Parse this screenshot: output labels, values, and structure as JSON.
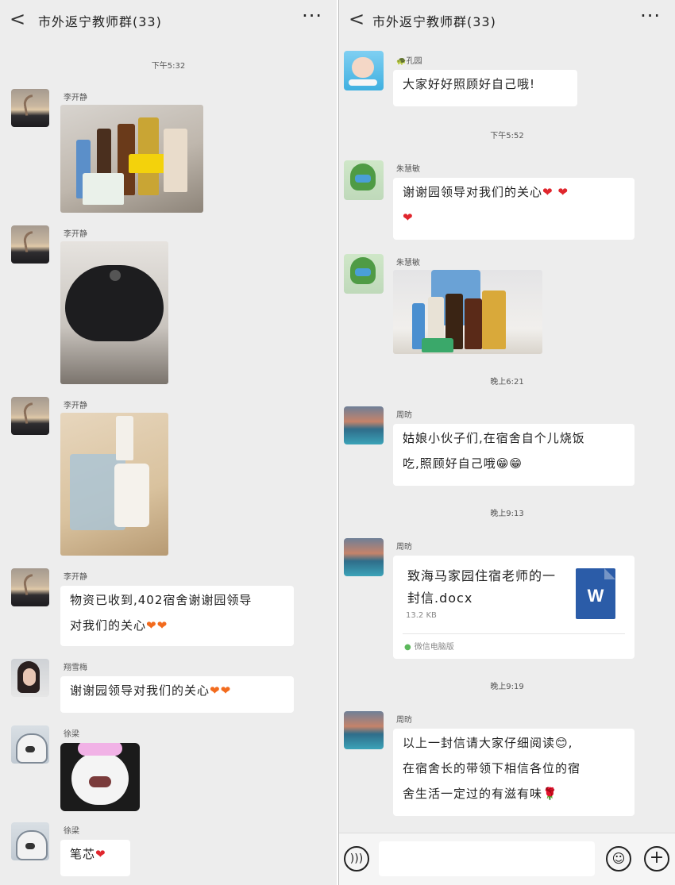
{
  "left": {
    "header": {
      "back": "<",
      "title": "市外返宁教师群(33)",
      "more": "···"
    },
    "time1": "下午5:32",
    "messages": [
      {
        "sender": "李开静"
      },
      {
        "sender": "李开静"
      },
      {
        "sender": "李开静"
      },
      {
        "sender": "李开静",
        "text": "物资已收到,402宿舍谢谢园领导",
        "text2": "对我们的关心"
      },
      {
        "sender": "翔雪梅",
        "text": "谢谢园领导对我们的关心"
      },
      {
        "sender": "徐梁"
      },
      {
        "sender": "徐梁",
        "text": "笔芯"
      }
    ]
  },
  "right": {
    "header": {
      "back": "<",
      "title": "市外返宁教师群(33)",
      "more": "···"
    },
    "messages": [
      {
        "sender": "🐢孔园",
        "text": "大家好好照顾好自己哦!"
      },
      {
        "sender": "朱慧敏",
        "text": "谢谢园领导对我们的关心"
      },
      {
        "sender": "朱慧敏"
      },
      {
        "sender": "周昉",
        "text": "姑娘小伙子们,在宿舍自个儿烧饭",
        "text2": "吃,照顾好自己哦😁😁"
      },
      {
        "sender": "周昉"
      },
      {
        "sender": "周昉",
        "text": "以上一封信请大家仔细阅读😊,",
        "text2": "在宿舍长的带领下相信各位的宿",
        "text3": "舍生活一定过的有滋有味🌹"
      }
    ],
    "time1": "下午5:52",
    "time2": "晚上6:21",
    "time3": "晚上9:13",
    "time4": "晚上9:19",
    "file": {
      "name": "致海马家园住宿老师的一封信.docx",
      "size": "13.2 KB",
      "source": "微信电脑版",
      "icon_letter": "W"
    }
  },
  "icons": [
    "back-icon",
    "more-icon",
    "voice-icon",
    "emoji-icon",
    "plus-icon",
    "word-file-icon",
    "heart-icon"
  ],
  "colors": {
    "background": "#ededed",
    "bubble": "#ffffff",
    "heart_red": "#e0262d",
    "heart_orange": "#f26b1e",
    "word_blue": "#2b5ca8"
  }
}
